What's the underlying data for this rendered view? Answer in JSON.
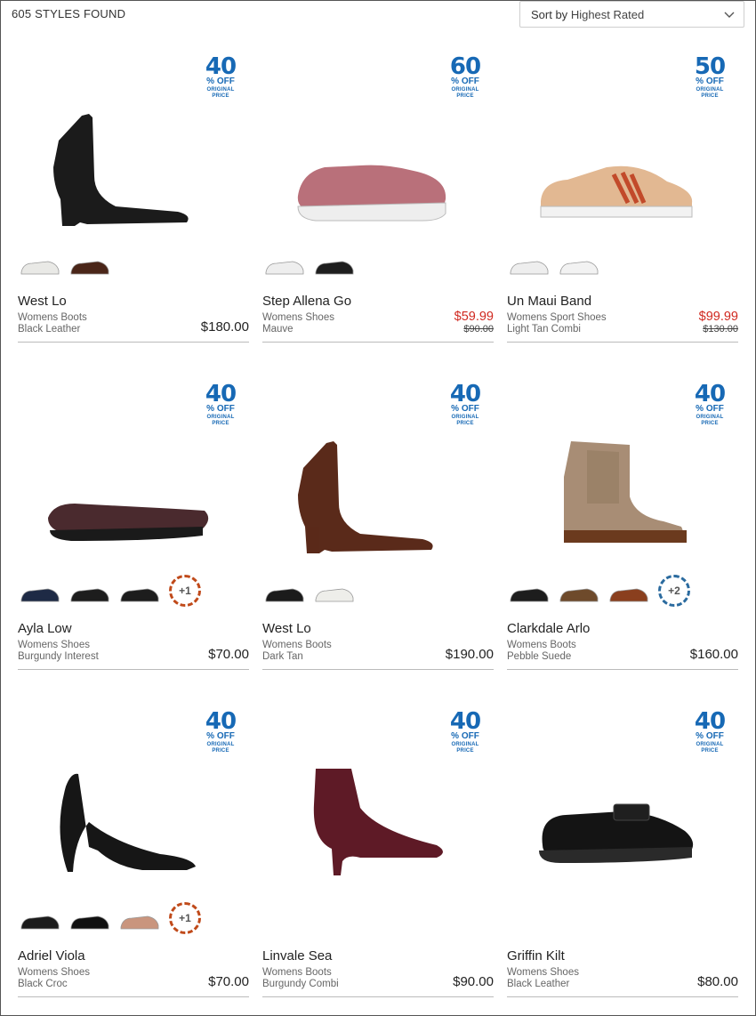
{
  "results_count": "605 STYLES FOUND",
  "sort": {
    "prefix": "Sort by",
    "value": "Highest Rated"
  },
  "promo_text": {
    "off": "% OFF",
    "orig_line1": "ORIGINAL",
    "orig_line2": "PRICE"
  },
  "colors": {
    "promo_blue": "#1769b5",
    "sale_red": "#d0281f"
  },
  "products": [
    {
      "name": "West Lo",
      "category": "Womens Boots",
      "color": "Black Leather",
      "price": "$180.00",
      "discount": "40",
      "shoe": "ankle-boot",
      "fill": "#1b1b1b",
      "swatches": [
        "#e9e9e6",
        "#4a2518"
      ]
    },
    {
      "name": "Step Allena Go",
      "category": "Womens Shoes",
      "color": "Mauve",
      "sale_price": "$59.99",
      "was_price": "$90.00",
      "discount": "60",
      "shoe": "sneaker",
      "fill": "#b9707a",
      "swatches": [
        "#eeeeee",
        "#1e1e1e"
      ]
    },
    {
      "name": "Un Maui Band",
      "category": "Womens Sport Shoes",
      "color": "Light Tan Combi",
      "sale_price": "$99.99",
      "was_price": "$130.00",
      "discount": "50",
      "shoe": "court-sneaker",
      "fill": "#e2b892",
      "swatches": [
        "#eeeeee",
        "#f2f2f2"
      ]
    },
    {
      "name": "Ayla Low",
      "category": "Womens Shoes",
      "color": "Burgundy Interest",
      "price": "$70.00",
      "discount": "40",
      "shoe": "flat",
      "fill": "#4a2a2e",
      "swatches": [
        "#1e2a45",
        "#1d1d1d",
        "#1d1d1d"
      ],
      "more": "+1"
    },
    {
      "name": "West Lo",
      "category": "Womens Boots",
      "color": "Dark Tan",
      "price": "$190.00",
      "discount": "40",
      "shoe": "ankle-boot",
      "fill": "#5a2a1a",
      "swatches": [
        "#1b1b1b",
        "#eeeeea"
      ]
    },
    {
      "name": "Clarkdale Arlo",
      "category": "Womens Boots",
      "color": "Pebble Suede",
      "price": "$160.00",
      "discount": "40",
      "shoe": "chelsea",
      "fill": "#a88d75",
      "swatches": [
        "#1d1d1d",
        "#6e4a2b",
        "#8a3f1e"
      ],
      "more": "+2"
    },
    {
      "name": "Adriel Viola",
      "category": "Womens Shoes",
      "color": "Black Croc",
      "price": "$70.00",
      "discount": "40",
      "shoe": "pump",
      "fill": "#161616",
      "swatches": [
        "#1b1b1b",
        "#111111",
        "#c9957e"
      ],
      "more": "+1"
    },
    {
      "name": "Linvale Sea",
      "category": "Womens Boots",
      "color": "Burgundy Combi",
      "price": "$90.00",
      "discount": "40",
      "shoe": "heel-bootie",
      "fill": "#5e1a26",
      "swatches": []
    },
    {
      "name": "Griffin Kilt",
      "category": "Womens Shoes",
      "color": "Black Leather",
      "price": "$80.00",
      "discount": "40",
      "shoe": "loafer",
      "fill": "#141414",
      "swatches": []
    }
  ]
}
